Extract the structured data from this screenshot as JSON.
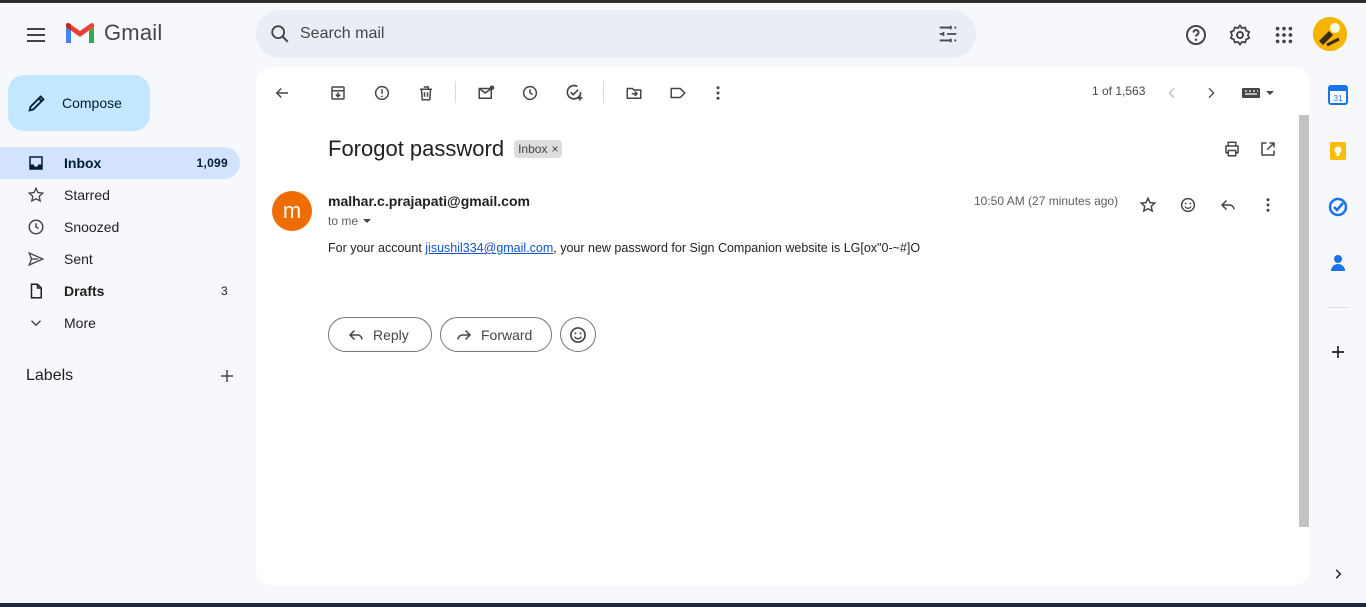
{
  "app": {
    "name": "Gmail"
  },
  "search": {
    "placeholder": "Search mail"
  },
  "compose": {
    "label": "Compose"
  },
  "sidebar": {
    "items": [
      {
        "label": "Inbox",
        "count": "1,099"
      },
      {
        "label": "Starred",
        "count": ""
      },
      {
        "label": "Snoozed",
        "count": ""
      },
      {
        "label": "Sent",
        "count": ""
      },
      {
        "label": "Drafts",
        "count": "3"
      },
      {
        "label": "More",
        "count": ""
      }
    ],
    "labels_title": "Labels"
  },
  "toolbar": {
    "pager": "1 of 1,563"
  },
  "email": {
    "subject": "Forogot password",
    "label_chip": "Inbox",
    "sender_initial": "m",
    "sender": "malhar.c.prajapati@gmail.com",
    "to": "to me",
    "time": "10:50 AM (27 minutes ago)",
    "body_prefix": "For your account ",
    "body_link": "jisushil334@gmail.com",
    "body_suffix": ", your new password for Sign Companion website is LG[ox\"0-~#]O"
  },
  "actions": {
    "reply": "Reply",
    "forward": "Forward"
  },
  "colors": {
    "accent_compose": "#c2e7ff",
    "active_nav": "#d3e3fd",
    "sender_avatar": "#ef6c00",
    "link": "#1155cc"
  }
}
